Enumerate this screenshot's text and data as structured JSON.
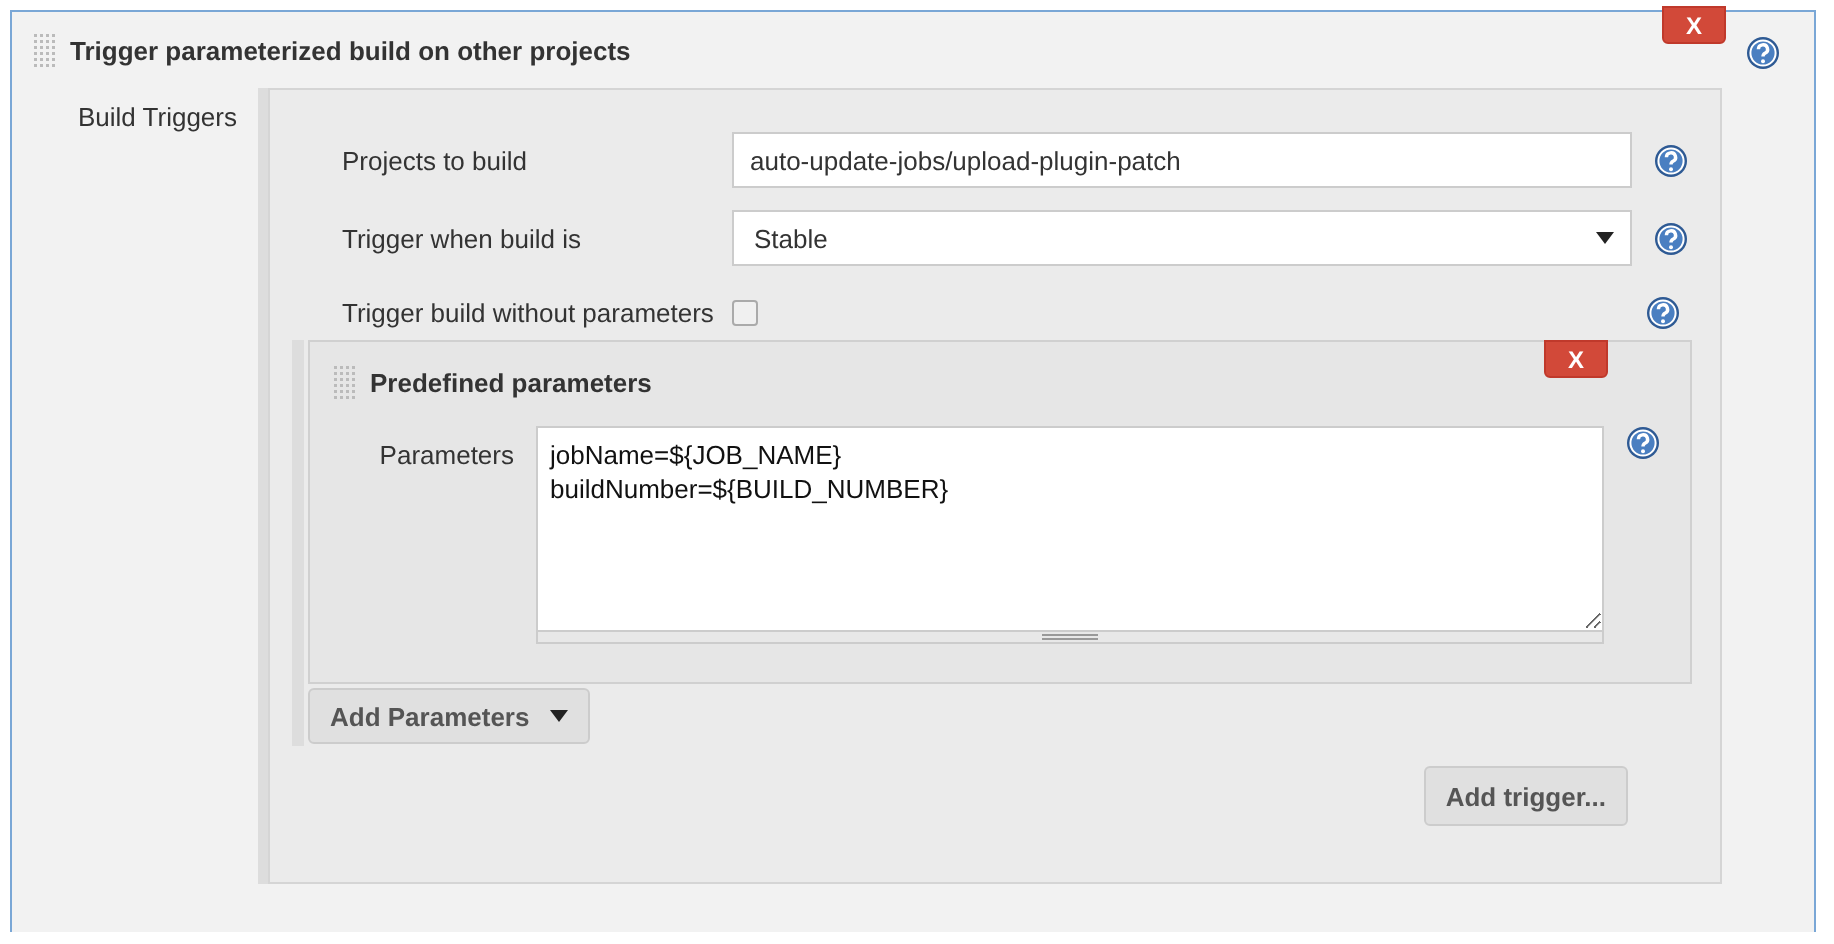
{
  "section": {
    "title": "Trigger parameterized build on other projects",
    "delete_label": "X"
  },
  "label": "Build Triggers",
  "fields": [
    {
      "kind": "text",
      "label": "Projects to build",
      "value": "auto-update-jobs/upload-plugin-patch"
    },
    {
      "kind": "select",
      "label": "Trigger when build is",
      "value": "Stable"
    },
    {
      "kind": "checkbox",
      "label": "Trigger build without parameters",
      "checked": false
    }
  ],
  "predefined": {
    "title": "Predefined parameters",
    "delete_label": "X",
    "label": "Parameters",
    "value": "jobName=${JOB_NAME}\nbuildNumber=${BUILD_NUMBER}"
  },
  "add_parameters": "Add Parameters",
  "add_trigger": "Add trigger..."
}
